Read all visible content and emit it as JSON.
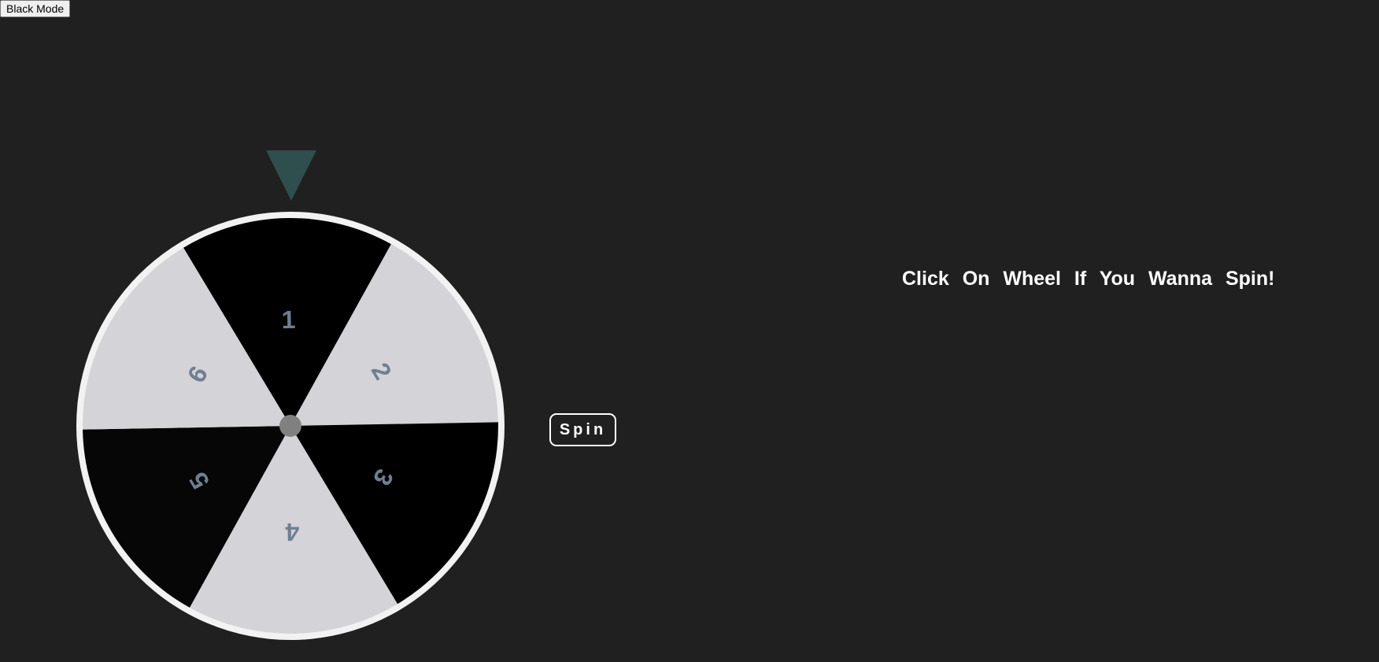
{
  "toolbar": {
    "mode_button_label": "Black Mode"
  },
  "wheel": {
    "pointer_color": "#2f4f4f",
    "rim_color": "#f2f2f2",
    "hub_color": "#808080",
    "label_color": "#6f7f91",
    "segments": [
      {
        "label": "1",
        "color": "#000000"
      },
      {
        "label": "2",
        "color": "#d4d3d8"
      },
      {
        "label": "3",
        "color": "#000000"
      },
      {
        "label": "4",
        "color": "#d4d3d8"
      },
      {
        "label": "5",
        "color": "#060606"
      },
      {
        "label": "6",
        "color": "#d4d3d8"
      }
    ]
  },
  "controls": {
    "spin_label": "Spin"
  },
  "message": {
    "text": "Click On Wheel If You Wanna Spin!"
  },
  "colors": {
    "background": "#202020",
    "text": "#ffffff"
  }
}
